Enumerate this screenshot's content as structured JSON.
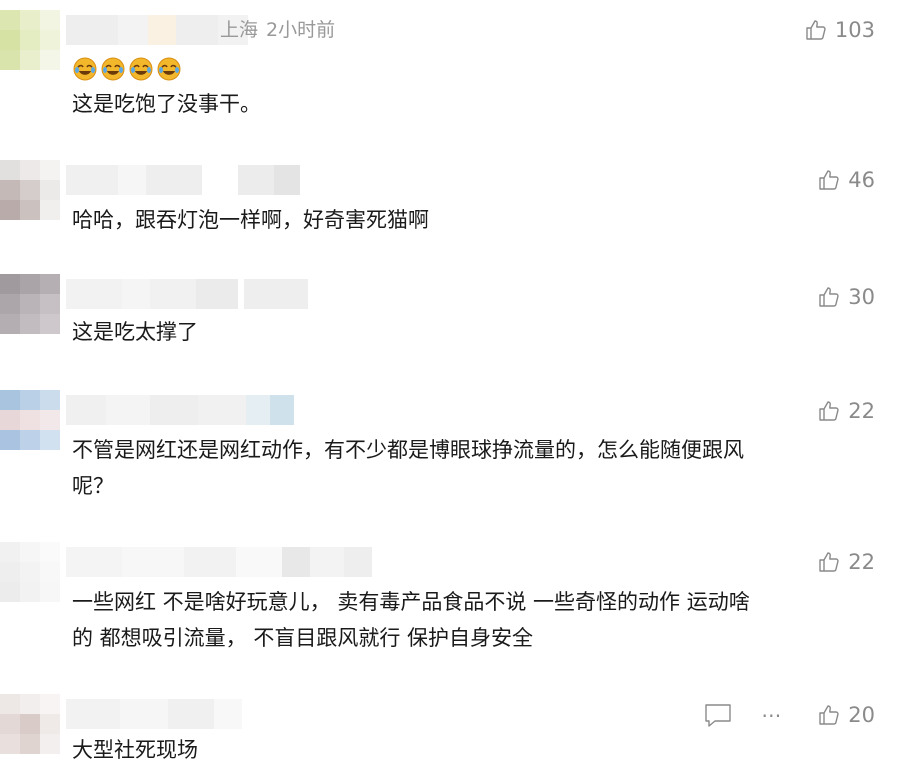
{
  "comments": [
    {
      "location": "上海",
      "time": "2小时前",
      "likes": "103",
      "emoji_icons": [
        "laughing-crying-emoji",
        "laughing-crying-emoji",
        "laughing-crying-emoji",
        "laughing-crying-emoji"
      ],
      "lines": [
        "这是吃饱了没事干。"
      ]
    },
    {
      "likes": "46",
      "lines": [
        "哈哈，跟吞灯泡一样啊，好奇害死猫啊"
      ]
    },
    {
      "likes": "30",
      "lines": [
        "这是吃太撑了"
      ]
    },
    {
      "likes": "22",
      "lines": [
        "不管是网红还是网红动作，有不少都是博眼球挣流量的，怎么能随便跟风",
        "呢？"
      ]
    },
    {
      "likes": "22",
      "lines": [
        "一些网红 不是啥好玩意儿， 卖有毒产品食品不说 一些奇怪的动作 运动啥",
        "的 都想吸引流量， 不盲目跟风就行  保护自身安全"
      ]
    },
    {
      "likes": "20",
      "lines": [
        "大型社死现场"
      ],
      "tools": [
        "reply-icon",
        "more-icon"
      ]
    }
  ],
  "colors": {
    "meta_text": "#999999",
    "like_text": "#8a8a8a",
    "body_text": "#1a1a1a",
    "emoji": "#f3b72b"
  }
}
